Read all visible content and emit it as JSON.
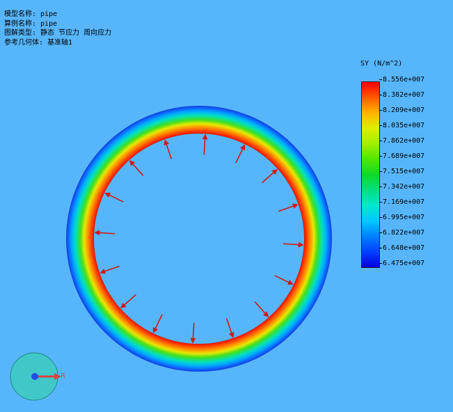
{
  "info": {
    "model_name": "模型名称: pipe",
    "study_name": "算例名称: pipe",
    "plot_type": "图解类型: 静态 节应力 周向应力",
    "ref_geometry": "参考几何体: 基准轴1"
  },
  "legend": {
    "title": "SY (N/m^2)",
    "ticks": [
      "8.556e+007",
      "8.382e+007",
      "8.209e+007",
      "8.035e+007",
      "7.862e+007",
      "7.689e+007",
      "7.515e+007",
      "7.342e+007",
      "7.169e+007",
      "6.995e+007",
      "6.822e+007",
      "6.648e+007",
      "6.475e+007"
    ],
    "colors": [
      "#ff0000",
      "#ff5a00",
      "#ffb400",
      "#dcef00",
      "#a0f000",
      "#50e800",
      "#10d828",
      "#00e080",
      "#00e8d0",
      "#00c8ff",
      "#0080ff",
      "#0040ff",
      "#0000e0"
    ]
  },
  "triad": {
    "axis_label": "R",
    "colors": {
      "disk": "#40c8c8",
      "arrow": "#e04040",
      "center": "#2050e0"
    }
  }
}
